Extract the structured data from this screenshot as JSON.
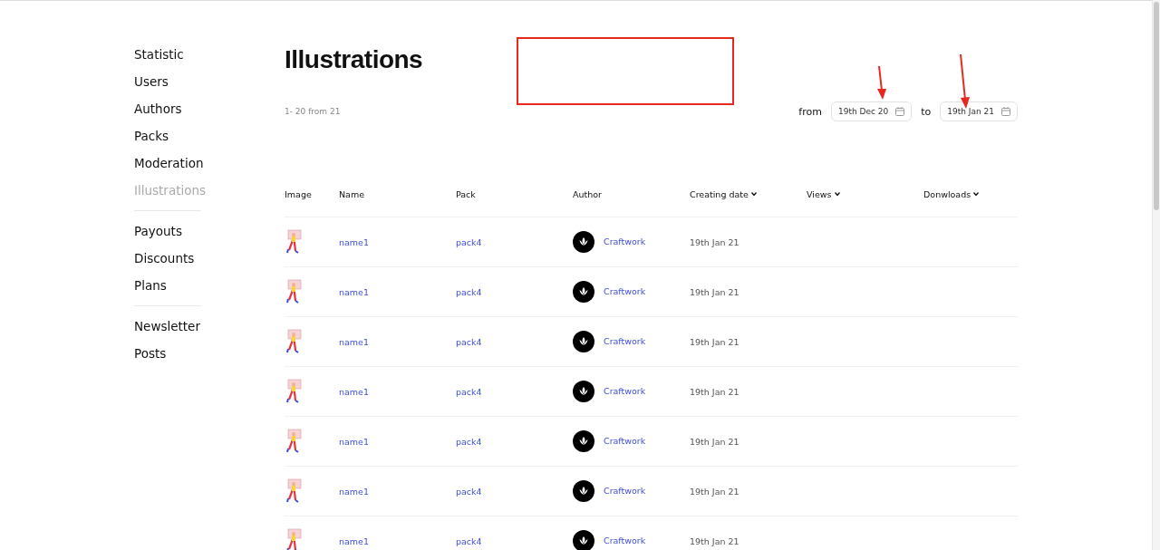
{
  "sidebar": {
    "groups": [
      {
        "items": [
          {
            "label": "Statistic",
            "selected": false
          },
          {
            "label": "Users",
            "selected": false
          },
          {
            "label": "Authors",
            "selected": false
          },
          {
            "label": "Packs",
            "selected": false
          },
          {
            "label": "Moderation",
            "selected": false
          },
          {
            "label": "Illustrations",
            "selected": true
          }
        ]
      },
      {
        "items": [
          {
            "label": "Payouts",
            "selected": false
          },
          {
            "label": "Discounts",
            "selected": false
          },
          {
            "label": "Plans",
            "selected": false
          }
        ]
      },
      {
        "items": [
          {
            "label": "Newsletter",
            "selected": false
          },
          {
            "label": "Posts",
            "selected": false
          }
        ]
      }
    ]
  },
  "page": {
    "title": "Illustrations",
    "count": "1- 20  from  21"
  },
  "date_filter": {
    "from_label": "from",
    "from_value": "19th Dec 20",
    "to_label": "to",
    "to_value": "19th Jan 21"
  },
  "table": {
    "columns": [
      {
        "label": "Image",
        "sortable": false
      },
      {
        "label": "Name",
        "sortable": false
      },
      {
        "label": "Pack",
        "sortable": false
      },
      {
        "label": "Author",
        "sortable": false
      },
      {
        "label": "Creating date",
        "sortable": true
      },
      {
        "label": "Views",
        "sortable": true
      },
      {
        "label": "Donwloads",
        "sortable": true
      }
    ],
    "rows": [
      {
        "name": "name1",
        "pack": "pack4",
        "author": "Craftwork",
        "date": "19th Jan 21"
      },
      {
        "name": "name1",
        "pack": "pack4",
        "author": "Craftwork",
        "date": "19th Jan 21"
      },
      {
        "name": "name1",
        "pack": "pack4",
        "author": "Craftwork",
        "date": "19th Jan 21"
      },
      {
        "name": "name1",
        "pack": "pack4",
        "author": "Craftwork",
        "date": "19th Jan 21"
      },
      {
        "name": "name1",
        "pack": "pack4",
        "author": "Craftwork",
        "date": "19th Jan 21"
      },
      {
        "name": "name1",
        "pack": "pack4",
        "author": "Craftwork",
        "date": "19th Jan 21"
      },
      {
        "name": "name1",
        "pack": "pack4",
        "author": "Craftwork",
        "date": "19th Jan 21"
      }
    ]
  }
}
